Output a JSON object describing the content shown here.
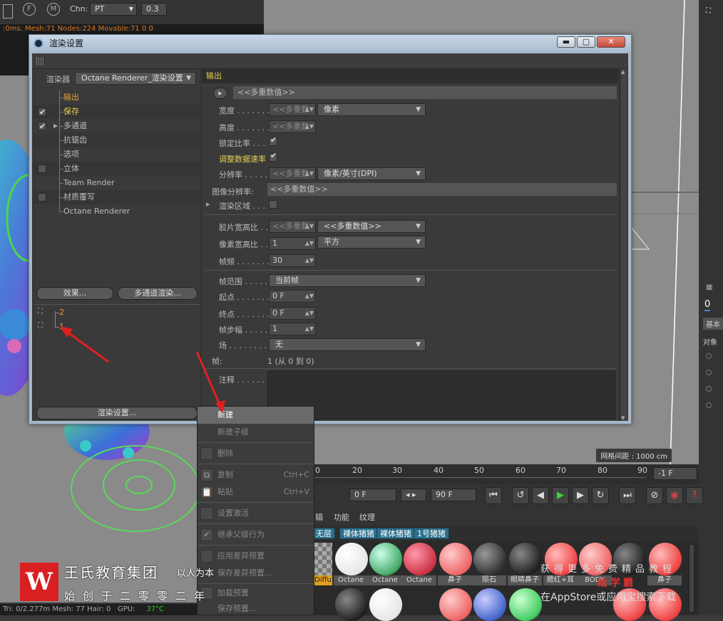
{
  "background": {
    "chn_label": "Chn:",
    "chn_value": "PT",
    "chn_num": "0.3",
    "status_line": ":0ms. Mesh:71 Nodes:224 Movable:71  0 0",
    "bottom_status": {
      "tri": "Tri: 0/2.277m Mesh: 77  Hair: 0",
      "gpu": "GPU:",
      "temp": "37°C"
    },
    "grid_spacing": "网格间距 : 1000 cm",
    "timeline": {
      "ticks": [
        "0",
        "10",
        "20",
        "30",
        "40",
        "50",
        "60",
        "70",
        "80",
        "90"
      ],
      "frame_field": "-1 F",
      "start_field": "0 F",
      "end_field": "90 F"
    },
    "material_menu": [
      "辑",
      "功能",
      "纹理"
    ],
    "material_tabs": [
      "无层",
      "裸体猪猪",
      "裸体猪猪",
      "1号猪猪"
    ],
    "material_labels": [
      "Diffu",
      "Octane",
      "Octane",
      "Octane",
      "鼻子",
      "陨石",
      "眼睛鼻子",
      "腮红+耳",
      "BODY",
      "鼻子"
    ],
    "right_panel": {
      "tab": "0",
      "basic": "基本",
      "obj": "对象"
    }
  },
  "dialog": {
    "title": "渲染设置",
    "controls": {
      "minimize": "▬",
      "maximize": "▢",
      "close": "✕"
    },
    "renderer_label": "渲染器",
    "renderer_value": "Octane Renderer_渲染设置",
    "tree": [
      {
        "label": "输出",
        "checkbox": false,
        "checked": false,
        "style": "orange"
      },
      {
        "label": "保存",
        "checkbox": true,
        "checked": true,
        "style": "yellow"
      },
      {
        "label": "多通道",
        "checkbox": true,
        "checked": true,
        "style": "normal"
      },
      {
        "label": "抗锯齿",
        "checkbox": false,
        "checked": false,
        "style": "normal"
      },
      {
        "label": "选项",
        "checkbox": false,
        "checked": false,
        "style": "normal"
      },
      {
        "label": "立体",
        "checkbox": true,
        "checked": false,
        "style": "normal"
      },
      {
        "label": "Team Render",
        "checkbox": false,
        "checked": false,
        "style": "normal"
      },
      {
        "label": "材质覆写",
        "checkbox": true,
        "checked": false,
        "style": "normal"
      },
      {
        "label": "Octane Renderer",
        "checkbox": false,
        "checked": false,
        "style": "normal"
      }
    ],
    "effects_button": "效果...",
    "multipass_button": "多通道渲染...",
    "presets": [
      "2",
      "1"
    ],
    "render_settings_button": "渲染设置...",
    "section_title": "输出",
    "multi_value_header": "<<多重数值>>",
    "fields": {
      "width_label": "宽度 . . . . . . . .",
      "width_value": "<<多重数",
      "width_unit": "像素",
      "height_label": "高度 . . . . . . . .",
      "height_value": "<<多重数",
      "lock_ratio_label": "锁定比率 . . . .",
      "adjust_rate_label": "调整数据速率",
      "resolution_label": "分辨率 . . . . . .",
      "resolution_value": "<<多重数",
      "resolution_unit": "像素/英寸(DPI)",
      "image_res_label": "图像分辨率:",
      "image_res_value": "<<多重数值>>",
      "render_region_label": "渲染区域 . . . .",
      "film_aspect_label": "胶片宽高比 . .",
      "film_aspect_value": "<<多重数",
      "film_aspect_dd": "<<多重数值>>",
      "pixel_aspect_label": "像素宽高比 . .",
      "pixel_aspect_value": "1",
      "pixel_aspect_dd": "平方",
      "fps_label": "帧频 . . . . . . . .",
      "fps_value": "30",
      "frame_range_label": "帧范围 . . . . . .",
      "frame_range_value": "当前帧",
      "start_label": "起点 . . . . . . . .",
      "start_value": "0 F",
      "end_label": "终点 . . . . . . . .",
      "end_value": "0 F",
      "step_label": "帧步幅 . . . . . .",
      "step_value": "1",
      "field_label": "场 . . . . . . . . . .",
      "field_value": "无",
      "frames_label": "帧:",
      "frames_value": "1 (从 0 到 0)",
      "notes_label": "注释 . . . . . . ."
    }
  },
  "context_menu": [
    {
      "label": "新建",
      "shortcut": "",
      "active": true
    },
    {
      "label": "新建子级",
      "shortcut": "",
      "active": false
    },
    {
      "label": "删除",
      "shortcut": "",
      "active": false
    },
    {
      "label": "复制",
      "shortcut": "Ctrl+C",
      "active": false
    },
    {
      "label": "粘贴",
      "shortcut": "Ctrl+V",
      "active": false
    },
    {
      "label": "设置激活",
      "shortcut": "",
      "active": false
    },
    {
      "label": "继承父级行为",
      "shortcut": "",
      "active": false
    },
    {
      "label": "应用差异预置",
      "shortcut": "",
      "active": false
    },
    {
      "label": "保存差异预置...",
      "shortcut": "",
      "active": false
    },
    {
      "label": "加载预置",
      "shortcut": "",
      "active": false
    },
    {
      "label": "保存预置...",
      "shortcut": "",
      "active": false
    }
  ],
  "watermark": {
    "logo": "W",
    "name": "王氏教育集团",
    "tagline": "以人为本",
    "subline": "始创于二零零二年",
    "right_line1": "获得更多免费精品教程",
    "right_line2": "绘学霸",
    "right_line3": "在AppStore或应用宝搜索下载"
  }
}
